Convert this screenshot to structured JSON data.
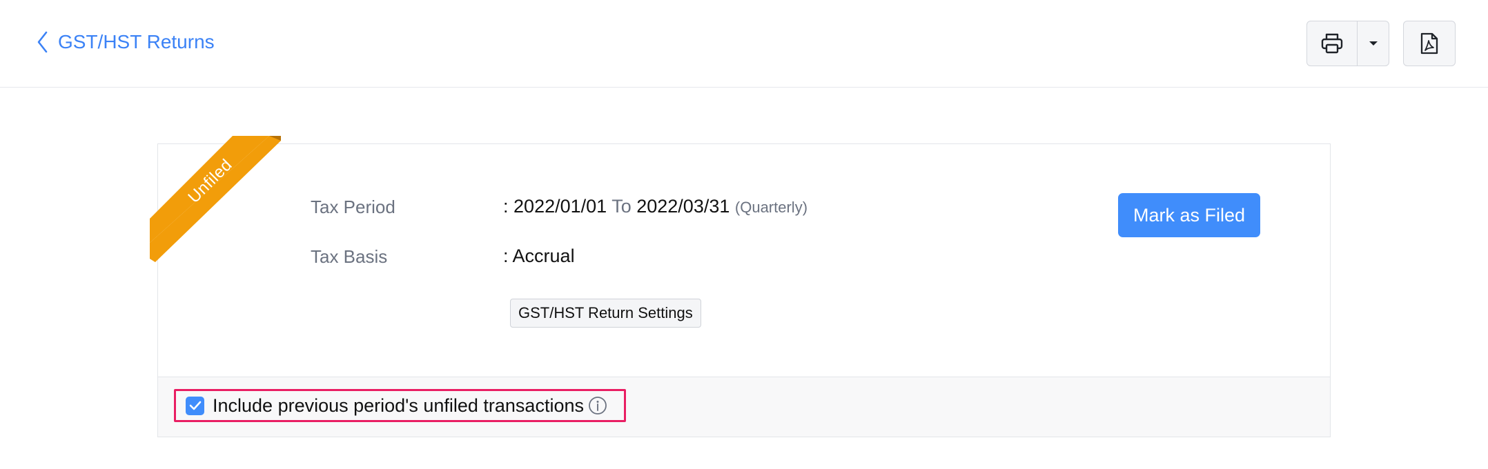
{
  "header": {
    "back_label": "GST/HST Returns",
    "back_icon": "chevron-left-icon",
    "print_icon": "printer-icon",
    "caret_icon": "caret-down-icon",
    "pdf_icon": "pdf-icon"
  },
  "status_ribbon": {
    "label": "Unfiled",
    "color": "#f29d0a"
  },
  "details": {
    "tax_period_label": "Tax Period",
    "tax_period_from": "2022/01/01",
    "tax_period_to_word": "To",
    "tax_period_to": "2022/03/31",
    "tax_period_frequency": "(Quarterly)",
    "tax_basis_label": "Tax Basis",
    "tax_basis_value": "Accrual",
    "separator": ":"
  },
  "actions": {
    "settings_label": "GST/HST Return Settings",
    "mark_filed_label": "Mark as Filed"
  },
  "footer": {
    "include_label": "Include previous period's unfiled transactions",
    "include_checked": true
  },
  "colors": {
    "accent": "#408dfb",
    "link": "#3b82f6",
    "highlight": "#e91e63"
  }
}
